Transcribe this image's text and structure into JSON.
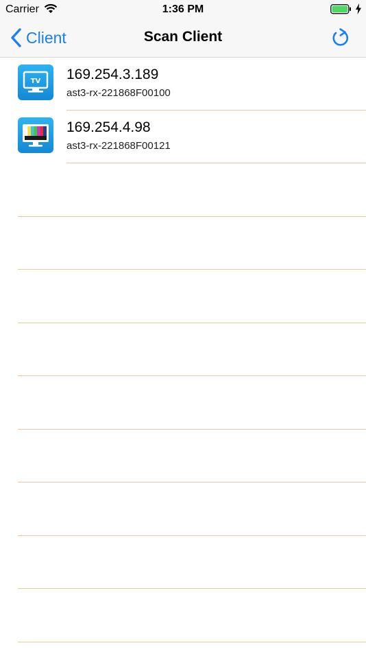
{
  "status": {
    "carrier": "Carrier",
    "time": "1:36 PM"
  },
  "nav": {
    "back_label": "Client",
    "title": "Scan Client"
  },
  "clients": [
    {
      "ip": "169.254.3.189",
      "host": "ast3-rx-221868F00100",
      "icon": "tv-icon",
      "icon_text": "TV"
    },
    {
      "ip": "169.254.4.98",
      "host": "ast3-rx-221868F00121",
      "icon": "color-bars-monitor-icon"
    }
  ],
  "colors": {
    "accent": "#1a7ff0",
    "separator": "#f0c8a0",
    "icon_bg": "#1a9be0",
    "battery": "#4cd964"
  }
}
